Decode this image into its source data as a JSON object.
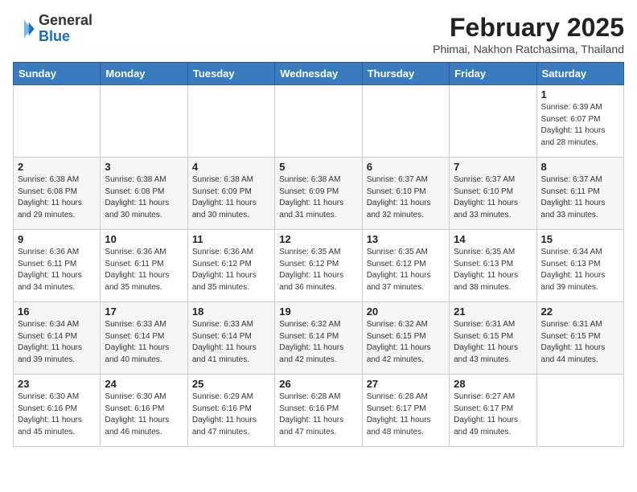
{
  "header": {
    "logo_general": "General",
    "logo_blue": "Blue",
    "month_title": "February 2025",
    "location": "Phimai, Nakhon Ratchasima, Thailand"
  },
  "weekdays": [
    "Sunday",
    "Monday",
    "Tuesday",
    "Wednesday",
    "Thursday",
    "Friday",
    "Saturday"
  ],
  "weeks": [
    [
      {
        "day": "",
        "info": ""
      },
      {
        "day": "",
        "info": ""
      },
      {
        "day": "",
        "info": ""
      },
      {
        "day": "",
        "info": ""
      },
      {
        "day": "",
        "info": ""
      },
      {
        "day": "",
        "info": ""
      },
      {
        "day": "1",
        "info": "Sunrise: 6:39 AM\nSunset: 6:07 PM\nDaylight: 11 hours\nand 28 minutes."
      }
    ],
    [
      {
        "day": "2",
        "info": "Sunrise: 6:38 AM\nSunset: 6:08 PM\nDaylight: 11 hours\nand 29 minutes."
      },
      {
        "day": "3",
        "info": "Sunrise: 6:38 AM\nSunset: 6:08 PM\nDaylight: 11 hours\nand 30 minutes."
      },
      {
        "day": "4",
        "info": "Sunrise: 6:38 AM\nSunset: 6:09 PM\nDaylight: 11 hours\nand 30 minutes."
      },
      {
        "day": "5",
        "info": "Sunrise: 6:38 AM\nSunset: 6:09 PM\nDaylight: 11 hours\nand 31 minutes."
      },
      {
        "day": "6",
        "info": "Sunrise: 6:37 AM\nSunset: 6:10 PM\nDaylight: 11 hours\nand 32 minutes."
      },
      {
        "day": "7",
        "info": "Sunrise: 6:37 AM\nSunset: 6:10 PM\nDaylight: 11 hours\nand 33 minutes."
      },
      {
        "day": "8",
        "info": "Sunrise: 6:37 AM\nSunset: 6:11 PM\nDaylight: 11 hours\nand 33 minutes."
      }
    ],
    [
      {
        "day": "9",
        "info": "Sunrise: 6:36 AM\nSunset: 6:11 PM\nDaylight: 11 hours\nand 34 minutes."
      },
      {
        "day": "10",
        "info": "Sunrise: 6:36 AM\nSunset: 6:11 PM\nDaylight: 11 hours\nand 35 minutes."
      },
      {
        "day": "11",
        "info": "Sunrise: 6:36 AM\nSunset: 6:12 PM\nDaylight: 11 hours\nand 35 minutes."
      },
      {
        "day": "12",
        "info": "Sunrise: 6:35 AM\nSunset: 6:12 PM\nDaylight: 11 hours\nand 36 minutes."
      },
      {
        "day": "13",
        "info": "Sunrise: 6:35 AM\nSunset: 6:12 PM\nDaylight: 11 hours\nand 37 minutes."
      },
      {
        "day": "14",
        "info": "Sunrise: 6:35 AM\nSunset: 6:13 PM\nDaylight: 11 hours\nand 38 minutes."
      },
      {
        "day": "15",
        "info": "Sunrise: 6:34 AM\nSunset: 6:13 PM\nDaylight: 11 hours\nand 39 minutes."
      }
    ],
    [
      {
        "day": "16",
        "info": "Sunrise: 6:34 AM\nSunset: 6:14 PM\nDaylight: 11 hours\nand 39 minutes."
      },
      {
        "day": "17",
        "info": "Sunrise: 6:33 AM\nSunset: 6:14 PM\nDaylight: 11 hours\nand 40 minutes."
      },
      {
        "day": "18",
        "info": "Sunrise: 6:33 AM\nSunset: 6:14 PM\nDaylight: 11 hours\nand 41 minutes."
      },
      {
        "day": "19",
        "info": "Sunrise: 6:32 AM\nSunset: 6:14 PM\nDaylight: 11 hours\nand 42 minutes."
      },
      {
        "day": "20",
        "info": "Sunrise: 6:32 AM\nSunset: 6:15 PM\nDaylight: 11 hours\nand 42 minutes."
      },
      {
        "day": "21",
        "info": "Sunrise: 6:31 AM\nSunset: 6:15 PM\nDaylight: 11 hours\nand 43 minutes."
      },
      {
        "day": "22",
        "info": "Sunrise: 6:31 AM\nSunset: 6:15 PM\nDaylight: 11 hours\nand 44 minutes."
      }
    ],
    [
      {
        "day": "23",
        "info": "Sunrise: 6:30 AM\nSunset: 6:16 PM\nDaylight: 11 hours\nand 45 minutes."
      },
      {
        "day": "24",
        "info": "Sunrise: 6:30 AM\nSunset: 6:16 PM\nDaylight: 11 hours\nand 46 minutes."
      },
      {
        "day": "25",
        "info": "Sunrise: 6:29 AM\nSunset: 6:16 PM\nDaylight: 11 hours\nand 47 minutes."
      },
      {
        "day": "26",
        "info": "Sunrise: 6:28 AM\nSunset: 6:16 PM\nDaylight: 11 hours\nand 47 minutes."
      },
      {
        "day": "27",
        "info": "Sunrise: 6:28 AM\nSunset: 6:17 PM\nDaylight: 11 hours\nand 48 minutes."
      },
      {
        "day": "28",
        "info": "Sunrise: 6:27 AM\nSunset: 6:17 PM\nDaylight: 11 hours\nand 49 minutes."
      },
      {
        "day": "",
        "info": ""
      }
    ]
  ]
}
